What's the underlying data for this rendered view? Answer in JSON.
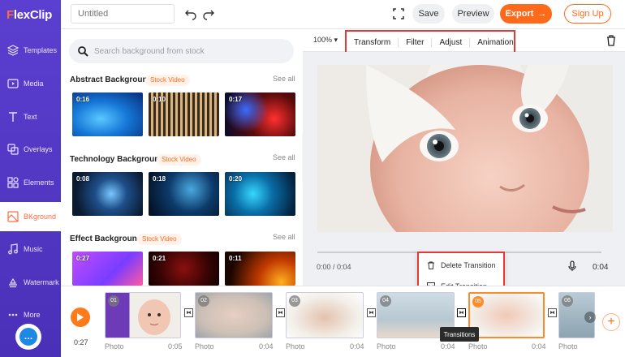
{
  "brand": {
    "logo_lead": "F",
    "logo_rest": "lexClip"
  },
  "sidebar": {
    "items": [
      {
        "label": "Templates",
        "icon": "layers-icon"
      },
      {
        "label": "Media",
        "icon": "media-icon"
      },
      {
        "label": "Text",
        "icon": "text-icon"
      },
      {
        "label": "Overlays",
        "icon": "overlays-icon"
      },
      {
        "label": "Elements",
        "icon": "elements-icon"
      },
      {
        "label": "BKground",
        "icon": "background-icon",
        "active": true
      },
      {
        "label": "Music",
        "icon": "music-icon"
      },
      {
        "label": "Watermark",
        "icon": "watermark-icon"
      },
      {
        "label": "More",
        "icon": "more-icon"
      }
    ]
  },
  "topbar": {
    "title_placeholder": "Untitled",
    "save": "Save",
    "preview": "Preview",
    "export": "Export",
    "signup": "Sign Up"
  },
  "panel": {
    "search_placeholder": "Search background from stock",
    "see_all": "See all",
    "badge": "Stock Video",
    "categories": [
      {
        "title": "Abstract Background",
        "durations": [
          "0:16",
          "0:10",
          "0:17"
        ]
      },
      {
        "title": "Technology Background",
        "durations": [
          "0:08",
          "0:18",
          "0:20"
        ]
      },
      {
        "title": "Effect Background",
        "durations": [
          "0:27",
          "0:21",
          "0:11"
        ]
      }
    ]
  },
  "preview": {
    "zoom": "100%",
    "tabs": [
      "Transform",
      "Filter",
      "Adjust",
      "Animation"
    ],
    "current_time": "0:00 / 0:04",
    "end_time": "0:04"
  },
  "context_menu": {
    "delete": "Delete Transition",
    "edit": "Edit Transition"
  },
  "timeline": {
    "total": "0:27",
    "tooltip": "Transitions",
    "clips": [
      {
        "num": "01",
        "label": "Photo",
        "dur": "0:05"
      },
      {
        "num": "02",
        "label": "Photo",
        "dur": "0:04"
      },
      {
        "num": "03",
        "label": "Photo",
        "dur": "0:04"
      },
      {
        "num": "04",
        "label": "Photo",
        "dur": "0:04"
      },
      {
        "num": "05",
        "label": "Photo",
        "dur": "0:04"
      },
      {
        "num": "06",
        "label": "Photo",
        "dur": ""
      }
    ]
  },
  "colors": {
    "accent": "#ff6a1a",
    "rail": "#5b3fd0",
    "highlight": "#e53935"
  }
}
